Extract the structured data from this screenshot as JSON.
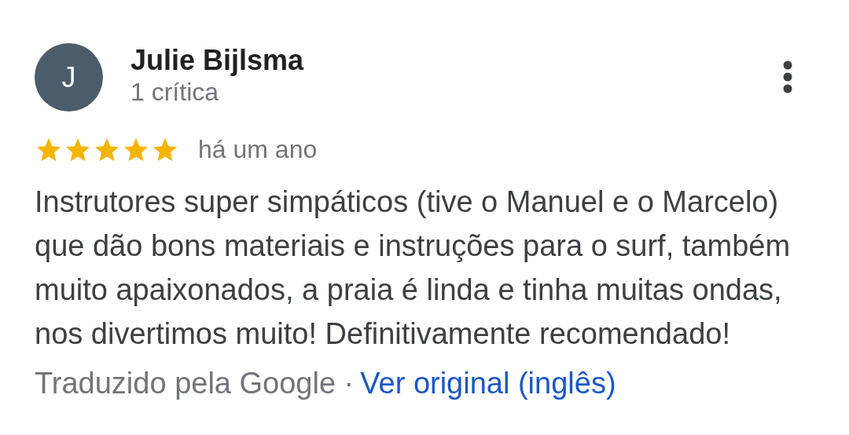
{
  "review": {
    "author": {
      "initial": "J",
      "name": "Julie Bijlsma",
      "review_count": "1 crítica"
    },
    "stars": 5,
    "time": "há um ano",
    "text": "Instrutores super simpáticos (tive o Manuel e o Marcelo) que dão bons materiais e instruções para o surf, também muito apaixonados, a praia é linda e tinha muitas ondas, nos divertimos muito! Definitivamente recomendado!",
    "translation_note": "Traduzido pela Google ·",
    "original_link": "Ver original (inglês)"
  }
}
